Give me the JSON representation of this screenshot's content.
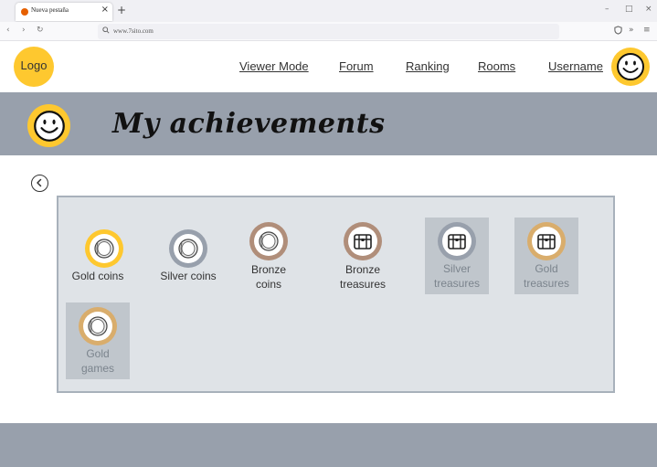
{
  "browser": {
    "tab_title": "Nueva pestaña",
    "url": "www.7sito.com",
    "tab_close": "×",
    "new_tab": "+",
    "window_controls": [
      "–",
      "□",
      "×"
    ],
    "nav_buttons": [
      "‹",
      "›",
      "↻"
    ]
  },
  "header": {
    "logo": "Logo",
    "nav": [
      "Viewer Mode",
      "Forum",
      "Ranking",
      "Rooms",
      "Username"
    ]
  },
  "banner": {
    "title": "My achievements"
  },
  "achievements": [
    {
      "label": "Gold coins",
      "icon": "coin-icon",
      "ring": "#fec82f",
      "locked": false
    },
    {
      "label": "Silver coins",
      "icon": "coin-icon",
      "ring": "#98a0ac",
      "locked": false
    },
    {
      "label": "Bronze coins",
      "icon": "coin-icon",
      "ring": "#b08e7a",
      "locked": false
    },
    {
      "label": "Bronze treasures",
      "icon": "treasure-chest-icon",
      "ring": "#b08e7a",
      "locked": false
    },
    {
      "label": "Silver treasures",
      "icon": "treasure-chest-icon",
      "ring": "#98a0ac",
      "locked": true
    },
    {
      "label": "Gold treasures",
      "icon": "treasure-chest-icon",
      "ring": "#d9ad6c",
      "locked": true
    },
    {
      "label": "Gold games",
      "icon": "coin-icon",
      "ring": "#d9ad6c",
      "locked": true
    }
  ],
  "colors": {
    "accent_yellow": "#fec82f",
    "banner_gray": "#98a0ac",
    "panel_bg": "#dfe3e7"
  }
}
